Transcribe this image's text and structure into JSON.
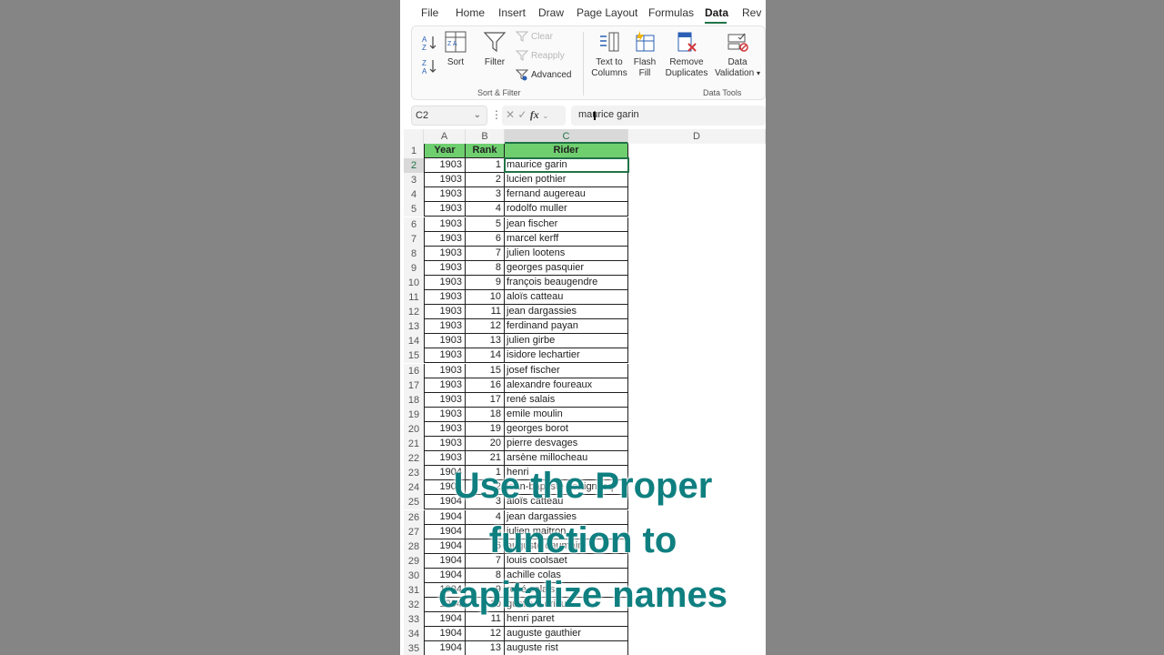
{
  "ribbon": {
    "tabs": [
      {
        "label": "File",
        "name": "tab-file"
      },
      {
        "label": "Home",
        "name": "tab-home"
      },
      {
        "label": "Insert",
        "name": "tab-insert"
      },
      {
        "label": "Draw",
        "name": "tab-draw"
      },
      {
        "label": "Page Layout",
        "name": "tab-page-layout"
      },
      {
        "label": "Formulas",
        "name": "tab-formulas"
      },
      {
        "label": "Data",
        "name": "tab-data",
        "active": true
      },
      {
        "label": "Rev",
        "name": "tab-review"
      }
    ],
    "sort_label": "Sort",
    "filter_label": "Filter",
    "clear_label": "Clear",
    "reapply_label": "Reapply",
    "advanced_label": "Advanced",
    "sort_filter_group": "Sort & Filter",
    "text_to_columns_label": "Text to Columns",
    "flash_fill_label": "Flash Fill",
    "remove_duplicates_label": "Remove Duplicates",
    "data_validation_label": "Data Validation",
    "data_tools_group": "Data Tools"
  },
  "formula_bar": {
    "name_box": "C2",
    "fx_label": "fx",
    "formula": "maurice garin"
  },
  "columns": [
    "A",
    "B",
    "C",
    "D"
  ],
  "header": {
    "year": "Year",
    "rank": "Rank",
    "rider": "Rider"
  },
  "rows": [
    {
      "n": "2",
      "year": "1903",
      "rank": "1",
      "rider": "maurice garin"
    },
    {
      "n": "3",
      "year": "1903",
      "rank": "2",
      "rider": "lucien pothier"
    },
    {
      "n": "4",
      "year": "1903",
      "rank": "3",
      "rider": "fernand augereau"
    },
    {
      "n": "5",
      "year": "1903",
      "rank": "4",
      "rider": "rodolfo muller"
    },
    {
      "n": "6",
      "year": "1903",
      "rank": "5",
      "rider": "jean fischer"
    },
    {
      "n": "7",
      "year": "1903",
      "rank": "6",
      "rider": "marcel kerff"
    },
    {
      "n": "8",
      "year": "1903",
      "rank": "7",
      "rider": "julien lootens"
    },
    {
      "n": "9",
      "year": "1903",
      "rank": "8",
      "rider": "georges pasquier"
    },
    {
      "n": "10",
      "year": "1903",
      "rank": "9",
      "rider": "françois beaugendre"
    },
    {
      "n": "11",
      "year": "1903",
      "rank": "10",
      "rider": "aloïs catteau"
    },
    {
      "n": "12",
      "year": "1903",
      "rank": "11",
      "rider": "jean dargassies"
    },
    {
      "n": "13",
      "year": "1903",
      "rank": "12",
      "rider": "ferdinand payan"
    },
    {
      "n": "14",
      "year": "1903",
      "rank": "13",
      "rider": "julien girbe"
    },
    {
      "n": "15",
      "year": "1903",
      "rank": "14",
      "rider": "isidore lechartier"
    },
    {
      "n": "16",
      "year": "1903",
      "rank": "15",
      "rider": "josef fischer"
    },
    {
      "n": "17",
      "year": "1903",
      "rank": "16",
      "rider": "alexandre foureaux"
    },
    {
      "n": "18",
      "year": "1903",
      "rank": "17",
      "rider": "rené salais"
    },
    {
      "n": "19",
      "year": "1903",
      "rank": "18",
      "rider": "emile moulin"
    },
    {
      "n": "20",
      "year": "1903",
      "rank": "19",
      "rider": "georges borot"
    },
    {
      "n": "21",
      "year": "1903",
      "rank": "20",
      "rider": "pierre desvages"
    },
    {
      "n": "22",
      "year": "1903",
      "rank": "21",
      "rider": "arsène millocheau"
    },
    {
      "n": "23",
      "year": "1904",
      "rank": "1",
      "rider": "henri"
    },
    {
      "n": "24",
      "year": "1904",
      "rank": "2",
      "rider": "jean-baptiste dortignacq"
    },
    {
      "n": "25",
      "year": "1904",
      "rank": "3",
      "rider": "aloïs catteau"
    },
    {
      "n": "26",
      "year": "1904",
      "rank": "4",
      "rider": "jean dargassies"
    },
    {
      "n": "27",
      "year": "1904",
      "rank": "5",
      "rider": "julien maitron"
    },
    {
      "n": "28",
      "year": "1904",
      "rank": "6",
      "rider": "auguste daumain"
    },
    {
      "n": "29",
      "year": "1904",
      "rank": "7",
      "rider": "louis coolsaet"
    },
    {
      "n": "30",
      "year": "1904",
      "rank": "8",
      "rider": "achille colas"
    },
    {
      "n": "31",
      "year": "1904",
      "rank": "9",
      "rider": "rené salais"
    },
    {
      "n": "32",
      "year": "1904",
      "rank": "10",
      "rider": "gustave drioul"
    },
    {
      "n": "33",
      "year": "1904",
      "rank": "11",
      "rider": "henri paret"
    },
    {
      "n": "34",
      "year": "1904",
      "rank": "12",
      "rider": "auguste gauthier"
    },
    {
      "n": "35",
      "year": "1904",
      "rank": "13",
      "rider": "auguste rist"
    }
  ],
  "caption": [
    "Use the Proper",
    "function to",
    "capitalize names"
  ],
  "colors": {
    "accent": "#217346",
    "header_fill": "#6fcf6f",
    "caption": "#0f7f80"
  }
}
